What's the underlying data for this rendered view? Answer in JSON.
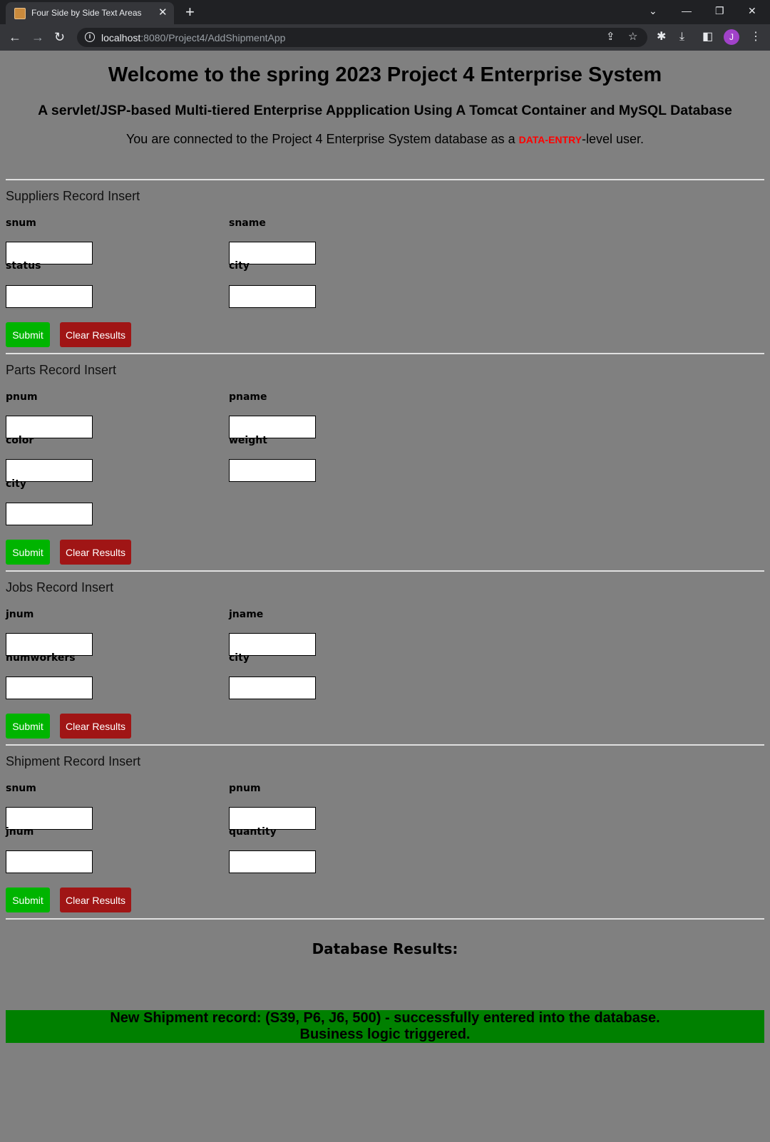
{
  "browser": {
    "tab_title": "Four Side by Side Text Areas",
    "url_host": "localhost",
    "url_path": ":8080/Project4/AddShipmentApp",
    "profile_initial": "J"
  },
  "header": {
    "title": "Welcome to the spring 2023 Project 4 Enterprise System",
    "subtitle": "A servlet/JSP-based Multi-tiered Enterprise Appplication Using A Tomcat Container and MySQL Database",
    "connection_prefix": "You are connected to the Project 4 Enterprise System database as a ",
    "role": "DATA-ENTRY",
    "connection_suffix": "-level user."
  },
  "suppliers": {
    "title": "Suppliers Record Insert",
    "fields": [
      "snum",
      "sname",
      "status",
      "city"
    ],
    "submit_label": "Submit",
    "clear_label": "Clear Results"
  },
  "parts": {
    "title": "Parts Record Insert",
    "fields": [
      "pnum",
      "pname",
      "color",
      "weight",
      "city"
    ],
    "submit_label": "Submit",
    "clear_label": "Clear Results"
  },
  "jobs": {
    "title": "Jobs Record Insert",
    "fields": [
      "jnum",
      "jname",
      "numworkers",
      "city"
    ],
    "submit_label": "Submit",
    "clear_label": "Clear Results"
  },
  "shipment": {
    "title": "Shipment Record Insert",
    "fields": [
      "snum",
      "pnum",
      "jnum",
      "quantity"
    ],
    "submit_label": "Submit",
    "clear_label": "Clear Results"
  },
  "results": {
    "title": "Database Results:",
    "line1": "New Shipment record: (S39, P6, J6, 500) - successfully entered into the database.",
    "line2": "Business logic triggered."
  },
  "colors": {
    "page_bg": "#808080",
    "submit_bg": "#00b400",
    "clear_bg": "#a01515",
    "result_bg": "#008000",
    "role_text": "#ff0000"
  }
}
